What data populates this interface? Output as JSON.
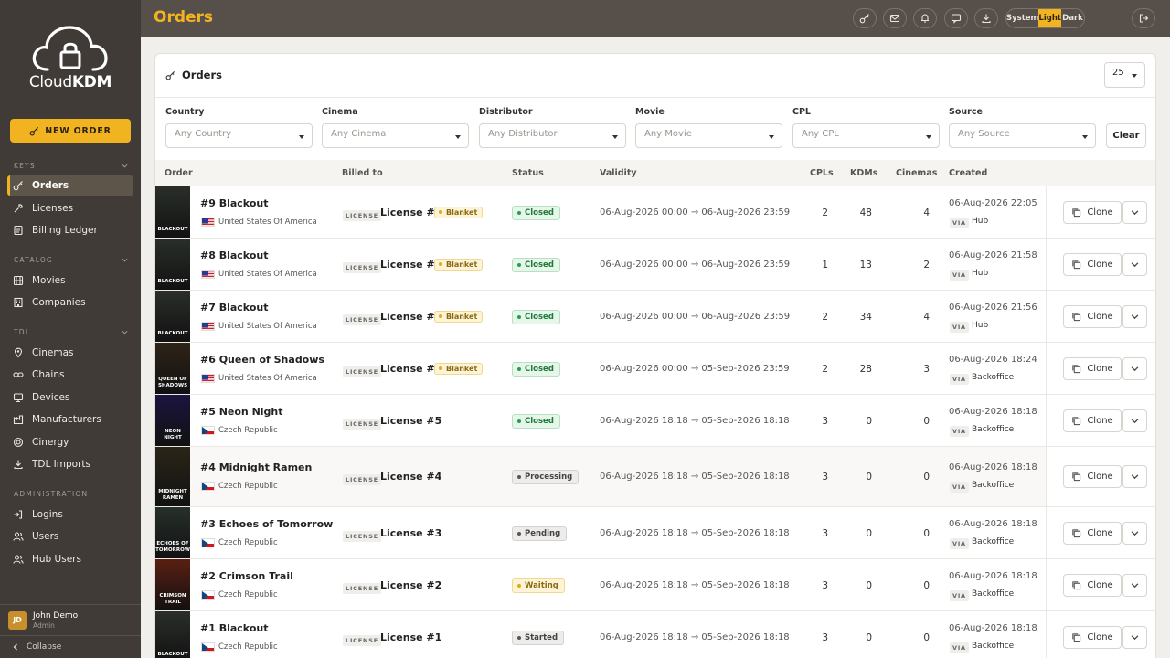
{
  "app": {
    "logo_prefix": "Cloud",
    "logo_suffix": "KDM",
    "page_title": "Orders"
  },
  "sidebar": {
    "new_order": "NEW ORDER",
    "sections": [
      {
        "title": "KEYS",
        "items": [
          {
            "label": "Orders",
            "icon": "key-icon",
            "active": true
          },
          {
            "label": "Licenses",
            "icon": "wrench-icon"
          },
          {
            "label": "Billing Ledger",
            "icon": "ledger-icon"
          }
        ]
      },
      {
        "title": "CATALOG",
        "items": [
          {
            "label": "Movies",
            "icon": "film-icon"
          },
          {
            "label": "Companies",
            "icon": "building-icon"
          }
        ]
      },
      {
        "title": "TDL",
        "items": [
          {
            "label": "Cinemas",
            "icon": "location-icon"
          },
          {
            "label": "Chains",
            "icon": "link-icon"
          },
          {
            "label": "Devices",
            "icon": "monitor-icon"
          },
          {
            "label": "Manufacturers",
            "icon": "factory-icon"
          },
          {
            "label": "Cinergy",
            "icon": "target-icon"
          },
          {
            "label": "TDL Imports",
            "icon": "import-icon"
          }
        ]
      },
      {
        "title": "ADMINISTRATION",
        "items": [
          {
            "label": "Logins",
            "icon": "login-icon"
          },
          {
            "label": "Users",
            "icon": "users-icon"
          },
          {
            "label": "Hub Users",
            "icon": "hub-users-icon"
          }
        ]
      }
    ],
    "user": {
      "initials": "JD",
      "name": "John Demo",
      "role": "Admin"
    },
    "collapse": "Collapse"
  },
  "topbar": {
    "icons": [
      "key-icon",
      "mail-icon",
      "bell-icon",
      "megaphone-icon",
      "download-icon"
    ],
    "theme": {
      "options": [
        "System",
        "Light",
        "Dark"
      ],
      "selected": "Light"
    },
    "logout_icon": "logout-icon"
  },
  "card": {
    "title": "Orders",
    "page_size": "25",
    "filters": [
      {
        "label": "Country",
        "placeholder": "Any Country"
      },
      {
        "label": "Cinema",
        "placeholder": "Any Cinema"
      },
      {
        "label": "Distributor",
        "placeholder": "Any Distributor"
      },
      {
        "label": "Movie",
        "placeholder": "Any Movie"
      },
      {
        "label": "CPL",
        "placeholder": "Any CPL"
      },
      {
        "label": "Source",
        "placeholder": "Any Source"
      }
    ],
    "clear": "Clear",
    "columns": {
      "order": "Order",
      "billed": "Billed to",
      "status": "Status",
      "validity": "Validity",
      "cpls": "CPLs",
      "kdms": "KDMs",
      "cinemas": "Cinemas",
      "created": "Created"
    },
    "license_tag": "LICENSE",
    "via_tag": "VIA",
    "clone_label": "Clone",
    "blanket_label": "Blanket"
  },
  "orders": [
    {
      "title": "#9 Blackout",
      "country": "United States Of America",
      "flag": "us",
      "license": "License #1",
      "blanket": true,
      "status": "Closed",
      "validity": "06-Aug-2026 00:00 → 06-Aug-2026 23:59",
      "cpls": "2",
      "kdms": "48",
      "cinemas": "4",
      "created": "06-Aug-2026 22:05",
      "via": "Hub",
      "poster_text": "BLACKOUT",
      "poster_color": "#2a2f2a"
    },
    {
      "title": "#8 Blackout",
      "country": "United States Of America",
      "flag": "us",
      "license": "License #1",
      "blanket": true,
      "status": "Closed",
      "validity": "06-Aug-2026 00:00 → 06-Aug-2026 23:59",
      "cpls": "1",
      "kdms": "13",
      "cinemas": "2",
      "created": "06-Aug-2026 21:58",
      "via": "Hub",
      "poster_text": "BLACKOUT",
      "poster_color": "#2a2f2a"
    },
    {
      "title": "#7 Blackout",
      "country": "United States Of America",
      "flag": "us",
      "license": "License #1",
      "blanket": true,
      "status": "Closed",
      "validity": "06-Aug-2026 00:00 → 06-Aug-2026 23:59",
      "cpls": "2",
      "kdms": "34",
      "cinemas": "4",
      "created": "06-Aug-2026 21:56",
      "via": "Hub",
      "poster_text": "BLACKOUT",
      "poster_color": "#2a2f2a"
    },
    {
      "title": "#6 Queen of Shadows",
      "country": "United States Of America",
      "flag": "us",
      "license": "License #8",
      "blanket": true,
      "status": "Closed",
      "validity": "06-Aug-2026 00:00 → 05-Sep-2026 23:59",
      "cpls": "2",
      "kdms": "28",
      "cinemas": "3",
      "created": "06-Aug-2026 18:24",
      "via": "Backoffice",
      "poster_text": "QUEEN OF SHADOWS",
      "poster_color": "#2e2418"
    },
    {
      "title": "#5 Neon Night",
      "country": "Czech Republic",
      "flag": "cz",
      "license": "License #5",
      "blanket": false,
      "status": "Closed",
      "validity": "06-Aug-2026 18:18 → 05-Sep-2026 18:18",
      "cpls": "3",
      "kdms": "0",
      "cinemas": "0",
      "created": "06-Aug-2026 18:18",
      "via": "Backoffice",
      "poster_text": "NEON NIGHT",
      "poster_color": "#1b1440"
    },
    {
      "title": "#4 Midnight Ramen",
      "country": "Czech Republic",
      "flag": "cz",
      "license": "License #4",
      "blanket": false,
      "status": "Processing",
      "validity": "06-Aug-2026 18:18 → 05-Sep-2026 18:18",
      "cpls": "3",
      "kdms": "0",
      "cinemas": "0",
      "created": "06-Aug-2026 18:18",
      "via": "Backoffice",
      "poster_text": "MIDNIGHT RAMEN",
      "poster_color": "#2a2518"
    },
    {
      "title": "#3 Echoes of Tomorrow",
      "country": "Czech Republic",
      "flag": "cz",
      "license": "License #3",
      "blanket": false,
      "status": "Pending",
      "validity": "06-Aug-2026 18:18 → 05-Sep-2026 18:18",
      "cpls": "3",
      "kdms": "0",
      "cinemas": "0",
      "created": "06-Aug-2026 18:18",
      "via": "Backoffice",
      "poster_text": "ECHOES OF TOMORROW",
      "poster_color": "#27302b"
    },
    {
      "title": "#2 Crimson Trail",
      "country": "Czech Republic",
      "flag": "cz",
      "license": "License #2",
      "blanket": false,
      "status": "Waiting",
      "validity": "06-Aug-2026 18:18 → 05-Sep-2026 18:18",
      "cpls": "3",
      "kdms": "0",
      "cinemas": "0",
      "created": "06-Aug-2026 18:18",
      "via": "Backoffice",
      "poster_text": "CRIMSON TRAIL",
      "poster_color": "#5a1f12"
    },
    {
      "title": "#1 Blackout",
      "country": "Czech Republic",
      "flag": "cz",
      "license": "License #1",
      "blanket": false,
      "status": "Started",
      "validity": "06-Aug-2026 18:18 → 05-Sep-2026 18:18",
      "cpls": "3",
      "kdms": "0",
      "cinemas": "0",
      "created": "06-Aug-2026 18:18",
      "via": "Backoffice",
      "poster_text": "BLACKOUT",
      "poster_color": "#2a2f2a"
    }
  ],
  "status_colors": {
    "Closed": {
      "bg": "#e6f6ea",
      "border": "#b7e2c2",
      "fg": "#1f7a3a",
      "dot": "#22a04b"
    },
    "Processing": {
      "bg": "#eeecea",
      "border": "#d6d2cd",
      "fg": "#444444",
      "dot": "#555555"
    },
    "Pending": {
      "bg": "#eeecea",
      "border": "#d6d2cd",
      "fg": "#444444",
      "dot": "#555555"
    },
    "Waiting": {
      "bg": "#fdf3d6",
      "border": "#f0d98d",
      "fg": "#8a6a10",
      "dot": "#e0a81a"
    },
    "Started": {
      "bg": "#eeecea",
      "border": "#d6d2cd",
      "fg": "#444444",
      "dot": "#555555"
    }
  },
  "accent": "#f2b320"
}
